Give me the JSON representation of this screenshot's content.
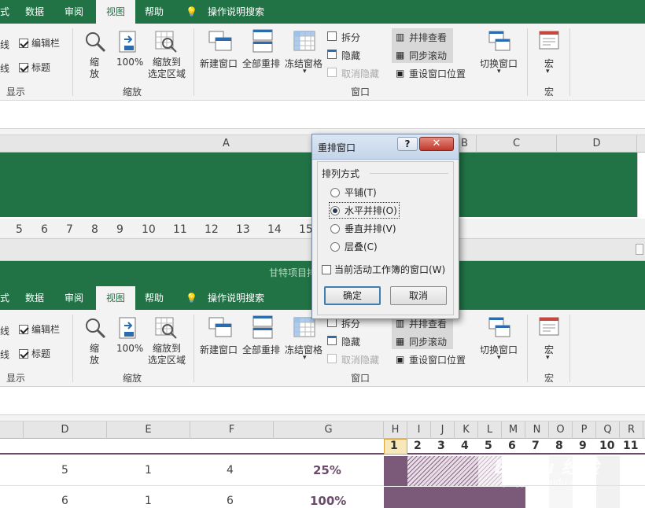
{
  "tabs": {
    "formula_cut": "式",
    "data": "数据",
    "review": "审阅",
    "view": "视图",
    "help": "帮助",
    "tell_me": "操作说明搜索"
  },
  "ribbon": {
    "show_group": {
      "formula_bar": "编辑栏",
      "headings": "标题",
      "gridlines_cut": "线",
      "label": "显示"
    },
    "zoom_group": {
      "zoom": "缩放",
      "zoom_100": "100%",
      "zoom_selection": "缩放到\n选定区域",
      "label": "缩放"
    },
    "window_group": {
      "new_window": "新建窗口",
      "arrange_all": "全部重排",
      "freeze_panes": "冻结窗格",
      "split": "拆分",
      "hide": "隐藏",
      "unhide": "取消隐藏",
      "view_side_by_side": "并排查看",
      "sync_scroll": "同步滚动",
      "reset_position": "重设窗口位置",
      "switch_windows": "切换窗口",
      "label": "窗口"
    },
    "macro_group": {
      "macros": "宏",
      "label": "宏"
    }
  },
  "top_sheet": {
    "col_a": "A",
    "col_b": "B",
    "col_c": "C",
    "col_d": "D",
    "timeline": [
      "5",
      "6",
      "7",
      "8",
      "9",
      "10",
      "11",
      "12",
      "13",
      "14",
      "15"
    ]
  },
  "bottom_window": {
    "title": "甘特项目排"
  },
  "bottom_sheet": {
    "columns": [
      "D",
      "E",
      "F",
      "G",
      "H",
      "I",
      "J",
      "K",
      "L",
      "M",
      "N",
      "O",
      "P",
      "Q",
      "R"
    ],
    "day_numbers": [
      "1",
      "2",
      "3",
      "4",
      "5",
      "6",
      "7",
      "8",
      "9",
      "10",
      "11"
    ],
    "rows": [
      {
        "d": "5",
        "e": "1",
        "f": "4",
        "g": "25%"
      },
      {
        "d": "6",
        "e": "1",
        "f": "6",
        "g": "100%"
      }
    ]
  },
  "dialog": {
    "title": "重排窗口",
    "help": "?",
    "group_label": "排列方式",
    "options": [
      "平铺(T)",
      "水平并排(O)",
      "垂直并排(V)",
      "层叠(C)"
    ],
    "selected_index": 1,
    "active_workbook_only": "当前活动工作簿的窗口(W)",
    "ok": "确定",
    "cancel": "取消"
  },
  "watermark": {
    "brand": "Baidu 经验",
    "url": "jingyan.baidu.com"
  },
  "colors": {
    "excel_green": "#217346",
    "gantt_purple": "#7a5a78",
    "percent_purple": "#6b4b6a",
    "dialog_close": "#c8463b"
  }
}
